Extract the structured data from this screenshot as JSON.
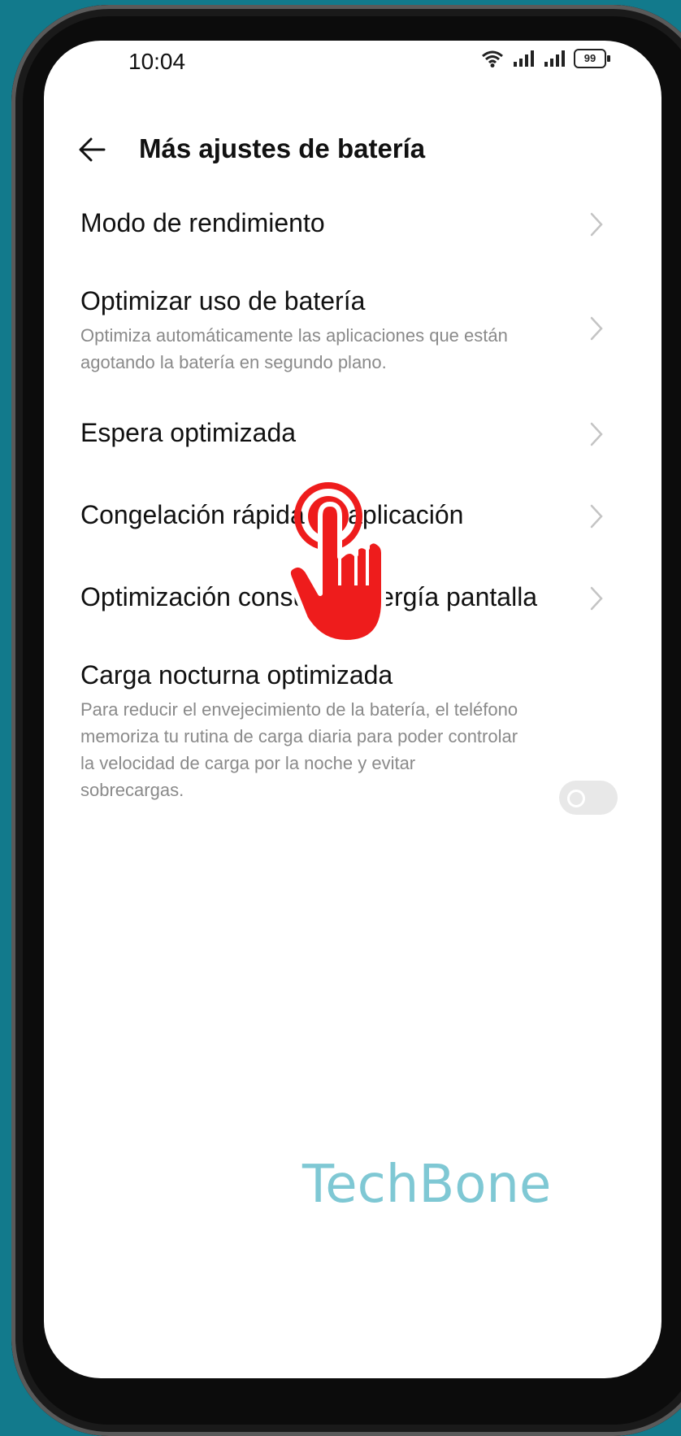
{
  "status": {
    "time": "10:04",
    "battery": "99"
  },
  "header": {
    "title": "Más ajustes de batería"
  },
  "settings": [
    {
      "title": "Modo de rendimiento",
      "subtitle": ""
    },
    {
      "title": "Optimizar uso de batería",
      "subtitle": "Optimiza automáticamente las aplicaciones que están agotando la batería en segundo plano."
    },
    {
      "title": "Espera optimizada",
      "subtitle": ""
    },
    {
      "title": "Congelación rápida de aplicación",
      "subtitle": ""
    },
    {
      "title": "Optimización consumo energía pantalla",
      "subtitle": ""
    },
    {
      "title": "Carga nocturna optimizada",
      "subtitle": "Para reducir el envejecimiento de la batería, el teléfono memoriza tu rutina de carga diaria para poder controlar la velocidad de carga por la noche y evitar sobrecargas.",
      "toggle_on": false
    }
  ],
  "colors": {
    "accent_hand": "#ee1c1c",
    "background": "#127a8c",
    "watermark": "#7fc8d4"
  },
  "icons": {
    "back": "arrow-left-icon",
    "chevron": "chevron-right-icon",
    "tap": "tap-hand-icon"
  },
  "watermark": "TechBone"
}
